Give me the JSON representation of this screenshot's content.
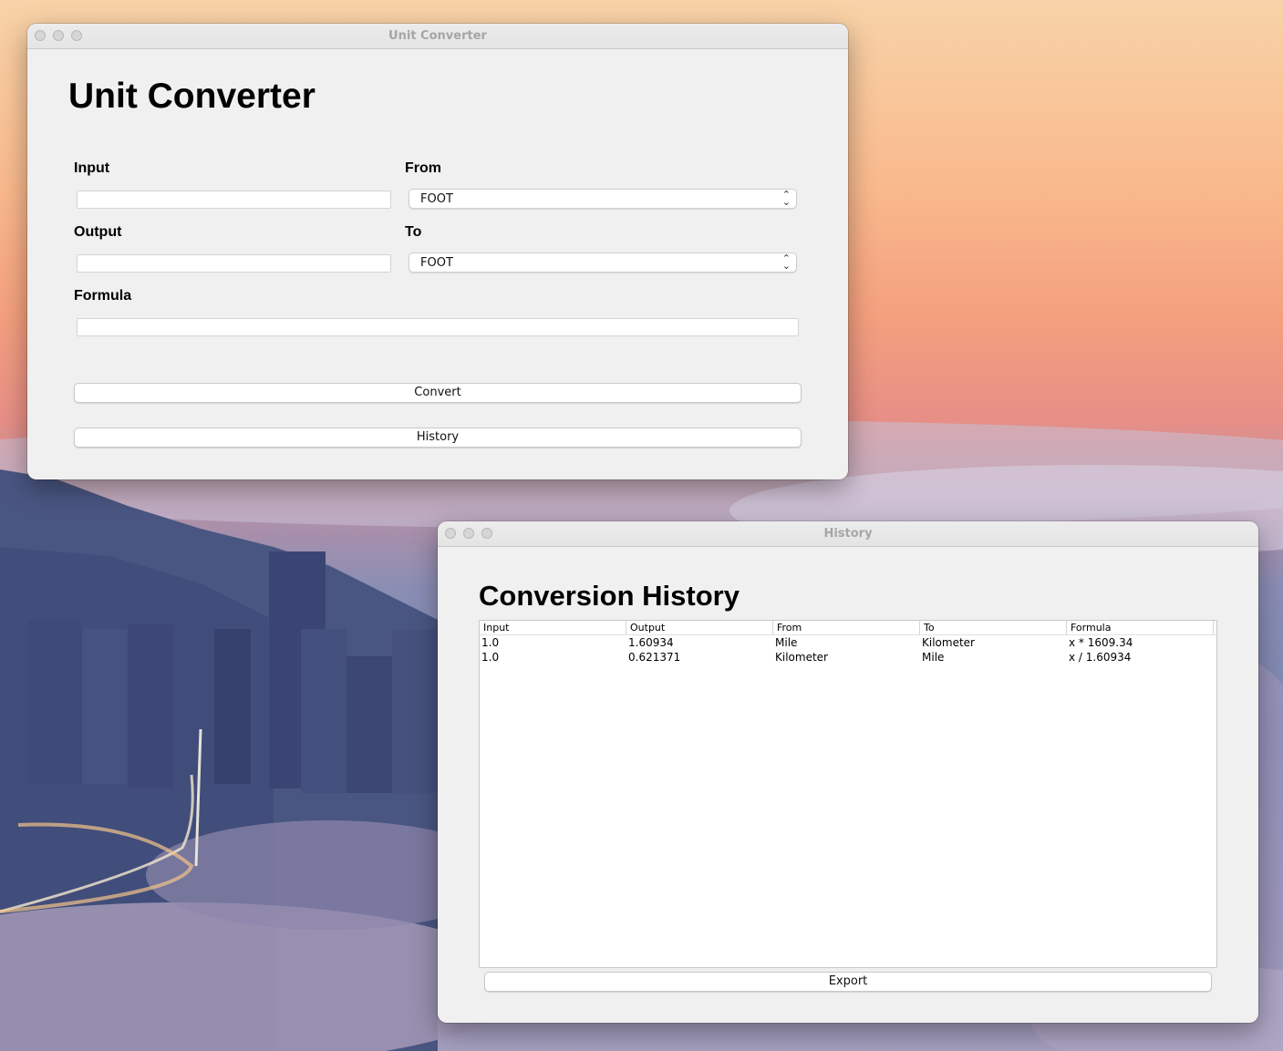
{
  "converter_window": {
    "title": "Unit Converter",
    "heading": "Unit Converter",
    "input_label": "Input",
    "input_value": "",
    "from_label": "From",
    "from_selected": "FOOT",
    "output_label": "Output",
    "output_value": "",
    "to_label": "To",
    "to_selected": "FOOT",
    "formula_label": "Formula",
    "formula_value": "",
    "convert_label": "Convert",
    "history_label": "History"
  },
  "history_window": {
    "title": "History",
    "heading": "Conversion History",
    "columns": [
      "Input",
      "Output",
      "From",
      "To",
      "Formula"
    ],
    "rows": [
      [
        "1.0",
        "1.60934",
        "Mile",
        "Kilometer",
        "x * 1609.34"
      ],
      [
        "1.0",
        "0.621371",
        "Kilometer",
        "Mile",
        "x / 1.60934"
      ]
    ],
    "export_label": "Export"
  }
}
